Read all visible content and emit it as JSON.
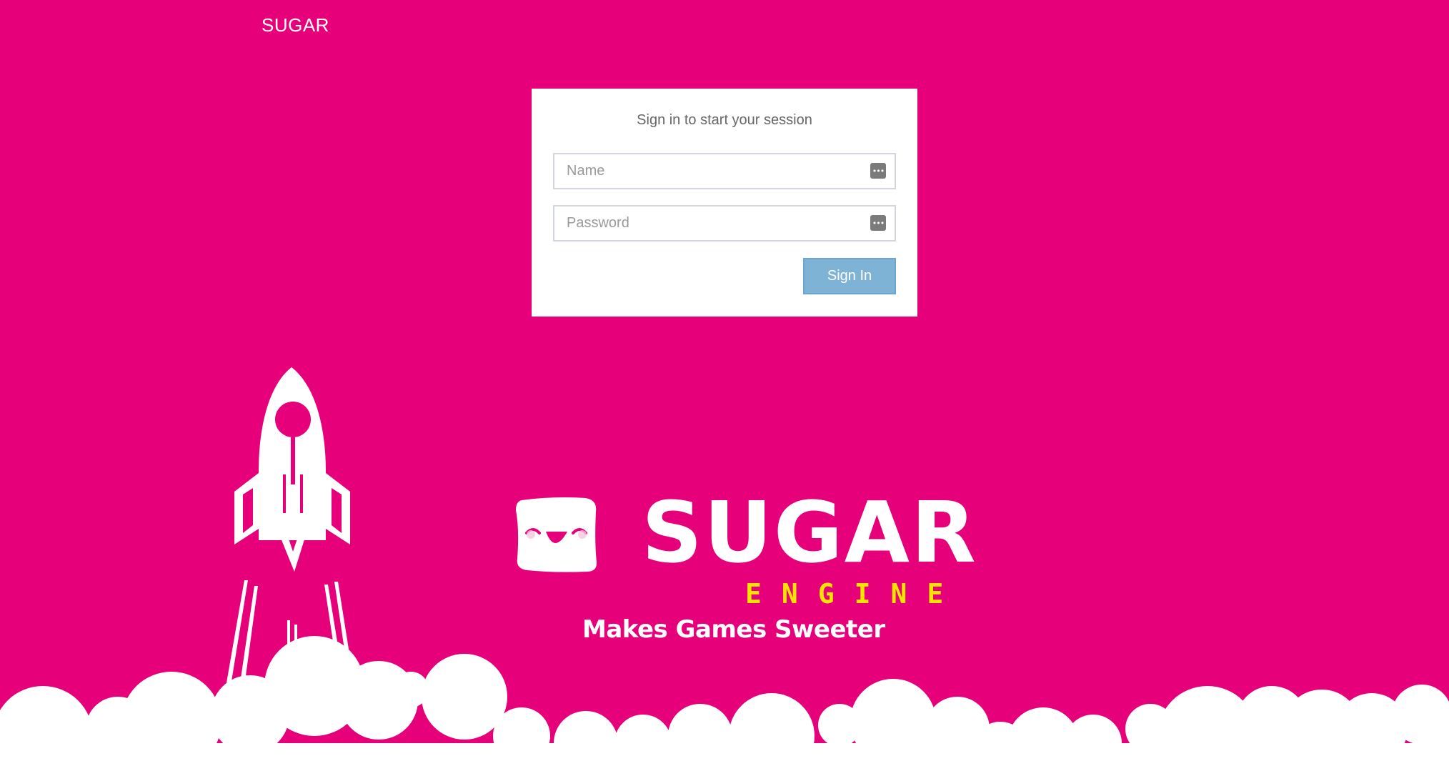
{
  "header": {
    "brand": "SUGAR"
  },
  "login": {
    "message": "Sign in to start your session",
    "name_placeholder": "Name",
    "password_placeholder": "Password",
    "signin_label": "Sign In"
  },
  "logo": {
    "wordmark": "SUGAR",
    "subword": "ENGINE",
    "tagline": "Makes Games Sweeter"
  },
  "icons": {
    "name_field_icon": "key-icon",
    "password_field_icon": "key-icon",
    "mascot": "smiling-cube-icon",
    "rocket": "rocket-icon"
  },
  "colors": {
    "background": "#e6007a",
    "panel": "#ffffff",
    "button": "#7fb3d6",
    "engine_text": "#f5e400"
  }
}
